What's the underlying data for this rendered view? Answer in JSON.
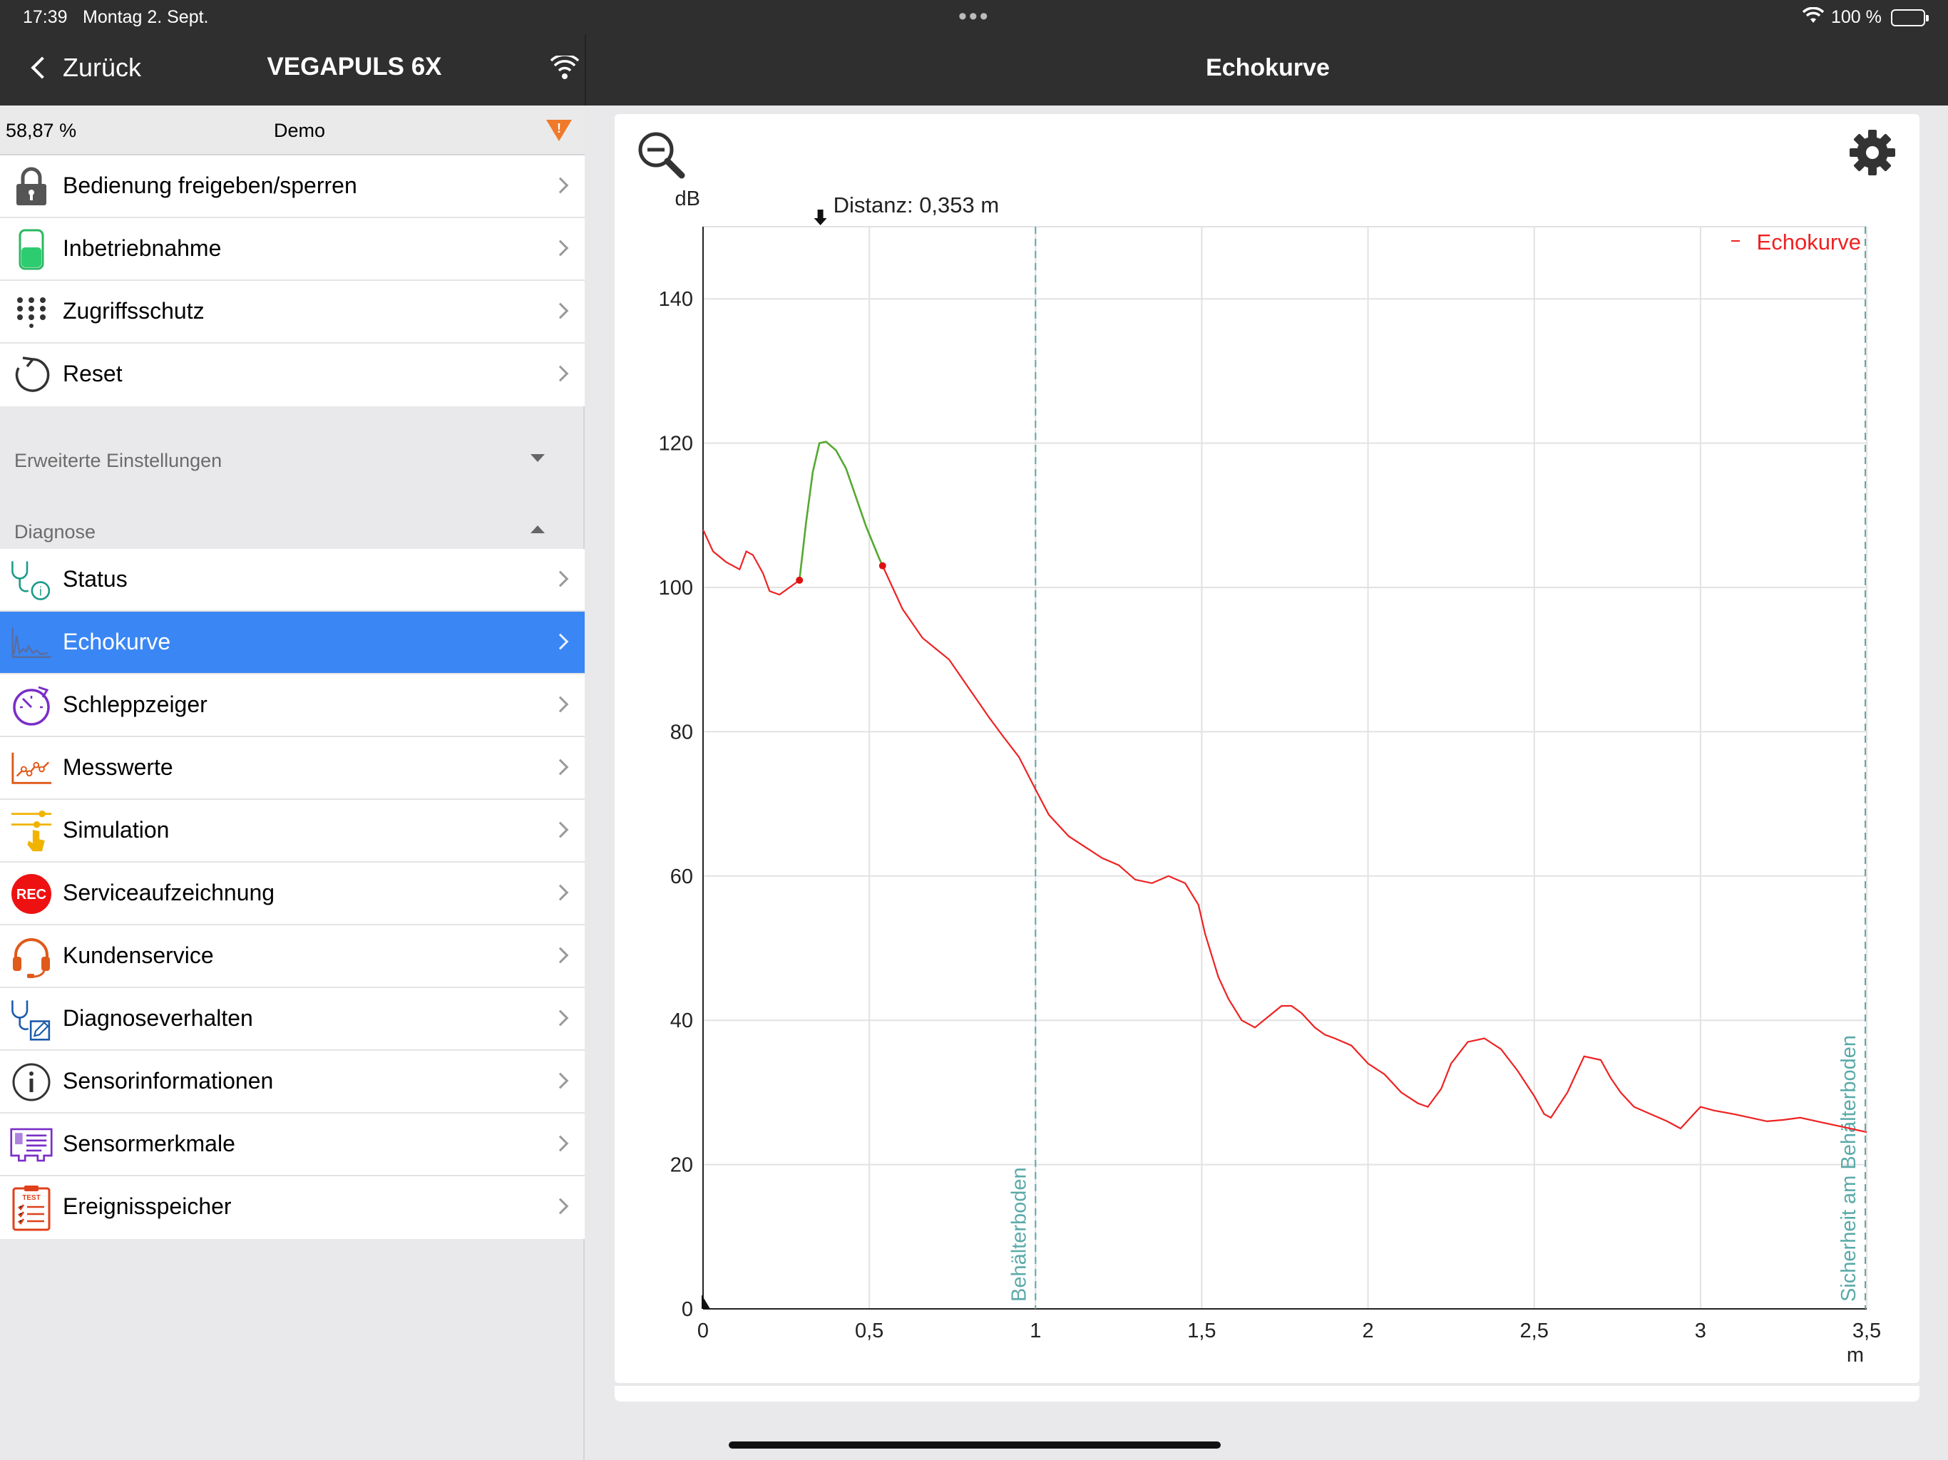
{
  "status_bar": {
    "time": "17:39",
    "date": "Montag 2. Sept.",
    "battery": "100 %"
  },
  "nav": {
    "back_label": "Zurück",
    "device_title": "VEGAPULS 6X",
    "right_title": "Echokurve"
  },
  "info_bar": {
    "percent": "58,87 %",
    "mode": "Demo"
  },
  "menu_top": [
    {
      "label": "Bedienung freigeben/sperren",
      "icon": "lock-icon"
    },
    {
      "label": "Inbetriebnahme",
      "icon": "battery-icon"
    },
    {
      "label": "Zugriffsschutz",
      "icon": "keypad-icon"
    },
    {
      "label": "Reset",
      "icon": "reset-icon"
    }
  ],
  "sections": {
    "advanced": "Erweiterte Einstellungen",
    "diagnosis": "Diagnose"
  },
  "menu_diag": [
    {
      "label": "Status",
      "icon": "stethoscope-info-icon"
    },
    {
      "label": "Echokurve",
      "icon": "echo-curve-icon",
      "active": true
    },
    {
      "label": "Schleppzeiger",
      "icon": "stopwatch-icon"
    },
    {
      "label": "Messwerte",
      "icon": "line-chart-icon"
    },
    {
      "label": "Simulation",
      "icon": "simulation-slider-icon"
    },
    {
      "label": "Serviceaufzeichnung",
      "icon": "rec-icon",
      "icon_text": "REC"
    },
    {
      "label": "Kundenservice",
      "icon": "headset-icon"
    },
    {
      "label": "Diagnoseverhalten",
      "icon": "stethoscope-edit-icon"
    },
    {
      "label": "Sensorinformationen",
      "icon": "info-icon"
    },
    {
      "label": "Sensormerkmale",
      "icon": "sensor-features-icon"
    },
    {
      "label": "Ereignisspeicher",
      "icon": "clipboard-test-icon",
      "icon_text": "TEST"
    }
  ],
  "colors": {
    "accent_blue": "#3a86f5",
    "curve_red": "#ee2222",
    "echo_green": "#55aa33",
    "marker_teal": "#5aaaa8",
    "warning_orange": "#f07a2a"
  },
  "chart_data": {
    "type": "line",
    "ylabel": "dB",
    "xlabel": "m",
    "xlim": [
      0,
      3.5
    ],
    "ylim": [
      0,
      150
    ],
    "x_ticks": [
      0,
      0.5,
      1,
      1.5,
      2,
      2.5,
      3,
      3.5
    ],
    "x_tick_labels": [
      "0",
      "0,5",
      "1",
      "1,5",
      "2",
      "2,5",
      "3",
      "3,5"
    ],
    "y_ticks": [
      0,
      20,
      40,
      60,
      80,
      100,
      120,
      140
    ],
    "y_tick_labels": [
      "0",
      "20",
      "40",
      "60",
      "80",
      "100",
      "120",
      "140"
    ],
    "grid": true,
    "legend": {
      "label": "Echokurve",
      "position": "top-right"
    },
    "distance_label": "Distanz: 0,353 m",
    "distance_value": 0.353,
    "series": [
      {
        "name": "Echokurve",
        "x": [
          0,
          0.03,
          0.07,
          0.11,
          0.13,
          0.15,
          0.18,
          0.2,
          0.23,
          0.26,
          0.29,
          0.31,
          0.33,
          0.35,
          0.37,
          0.4,
          0.43,
          0.46,
          0.49,
          0.53,
          0.57,
          0.6,
          0.63,
          0.66,
          0.7,
          0.74,
          0.77,
          0.8,
          0.83,
          0.86,
          0.9,
          0.95,
          1.0,
          1.04,
          1.07,
          1.1,
          1.15,
          1.2,
          1.25,
          1.3,
          1.35,
          1.4,
          1.45,
          1.49,
          1.51,
          1.55,
          1.58,
          1.62,
          1.66,
          1.7,
          1.74,
          1.77,
          1.8,
          1.84,
          1.87,
          1.9,
          1.95,
          2.0,
          2.05,
          2.1,
          2.15,
          2.18,
          2.22,
          2.25,
          2.3,
          2.35,
          2.4,
          2.45,
          2.5,
          2.53,
          2.55,
          2.6,
          2.63,
          2.65,
          2.7,
          2.73,
          2.76,
          2.8,
          2.85,
          2.9,
          2.94,
          2.98,
          3.0,
          3.04,
          3.1,
          3.15,
          3.2,
          3.25,
          3.3,
          3.35,
          3.4,
          3.45,
          3.5
        ],
        "y": [
          108,
          105,
          103.5,
          102.5,
          105,
          104.5,
          102,
          99.5,
          99,
          100,
          101,
          109,
          116,
          120,
          120.2,
          119,
          116.5,
          112.5,
          108.5,
          104,
          100,
          97,
          95,
          93,
          91.5,
          90,
          88,
          86,
          84,
          82,
          79.5,
          76.5,
          72,
          68.5,
          67,
          65.5,
          64,
          62.5,
          61.5,
          59.5,
          59,
          60,
          59,
          56,
          52,
          46,
          43,
          40,
          39,
          40.5,
          42,
          42,
          41,
          39,
          38,
          37.5,
          36.5,
          34,
          32.5,
          30,
          28.5,
          28,
          30.5,
          34,
          37,
          37.5,
          36,
          33,
          29.5,
          27,
          26.5,
          30,
          33,
          35,
          34.5,
          32,
          30,
          28,
          27,
          26,
          25,
          27,
          28,
          27.5,
          27,
          26.5,
          26,
          26.2,
          26.5,
          26,
          25.5,
          25,
          24.5
        ]
      }
    ],
    "echo_segment": {
      "x_start": 0.29,
      "x_end": 0.54
    },
    "annotations": [
      {
        "x": 1.0,
        "text": "Behälterboden"
      },
      {
        "x": 3.5,
        "text": "Sicherheit am Behälterboden"
      }
    ]
  }
}
